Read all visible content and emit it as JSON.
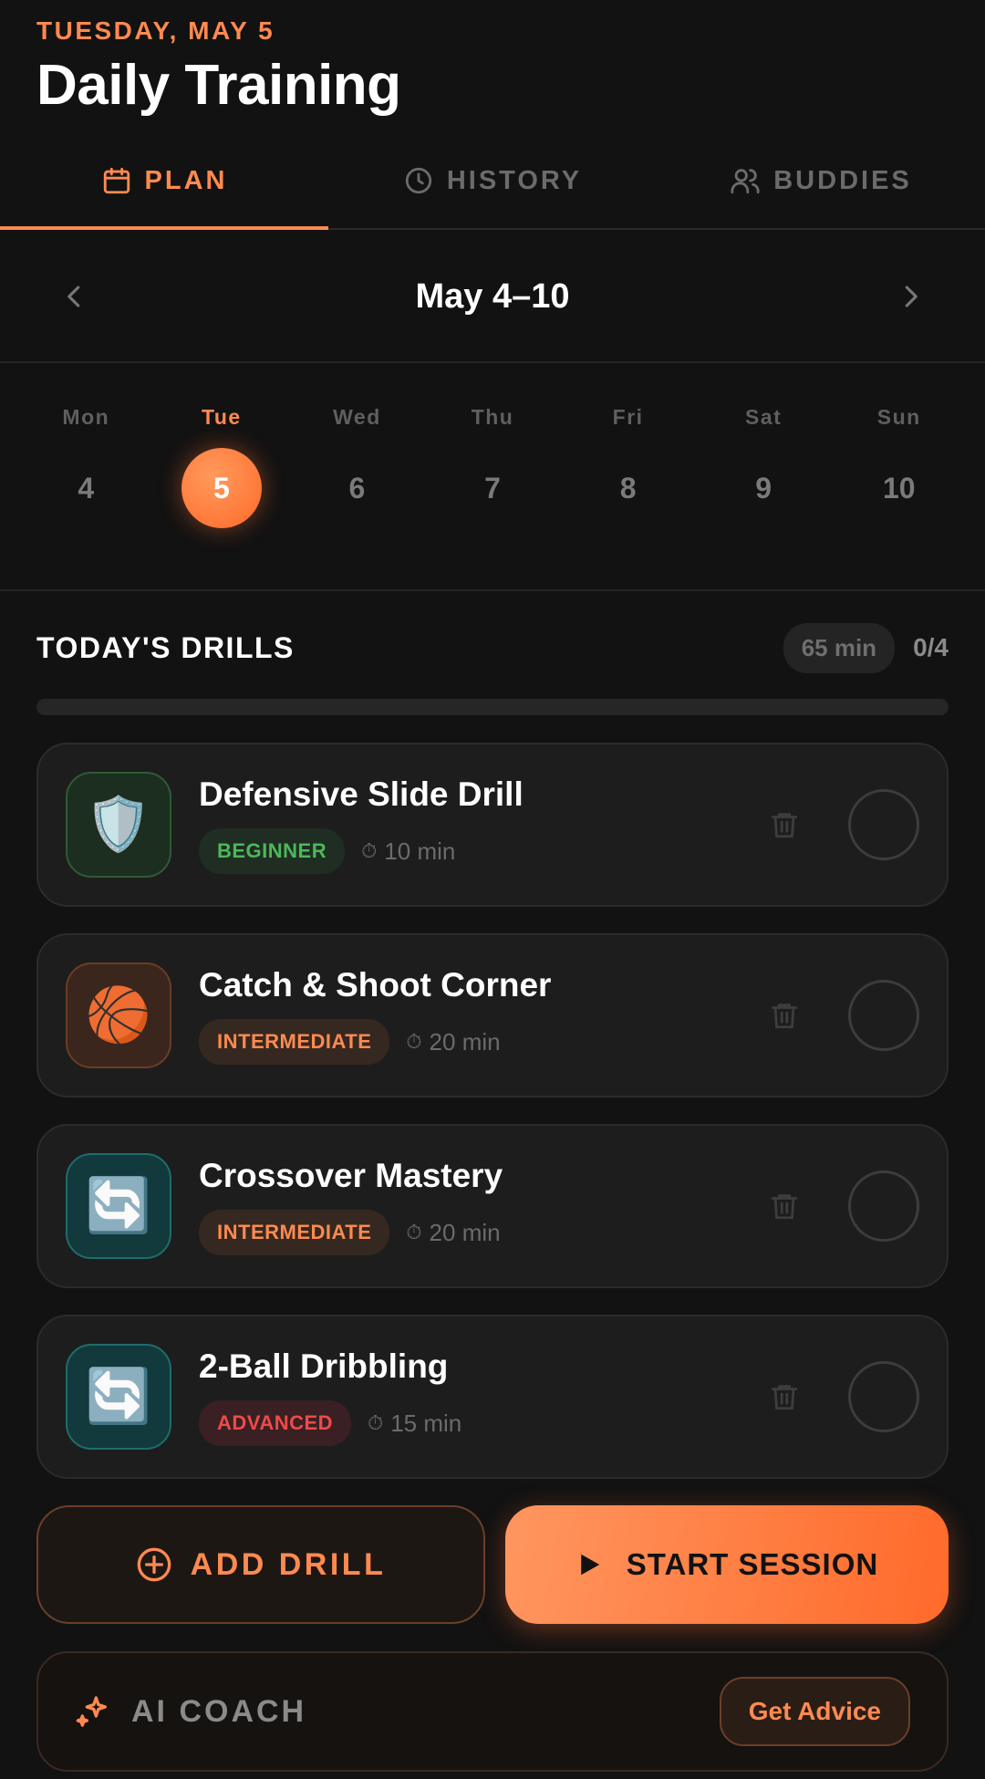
{
  "header": {
    "date": "TUESDAY, MAY 5",
    "title": "Daily Training"
  },
  "tabs": [
    {
      "label": "PLAN",
      "icon": "calendar-icon",
      "active": true
    },
    {
      "label": "HISTORY",
      "icon": "clock-icon",
      "active": false
    },
    {
      "label": "BUDDIES",
      "icon": "users-icon",
      "active": false
    }
  ],
  "week": {
    "title": "May 4–10",
    "prev_icon": "chevron-left-icon",
    "next_icon": "chevron-right-icon"
  },
  "days": [
    {
      "name": "Mon",
      "num": "4"
    },
    {
      "name": "Tue",
      "num": "5",
      "active": true
    },
    {
      "name": "Wed",
      "num": "6"
    },
    {
      "name": "Thu",
      "num": "7"
    },
    {
      "name": "Fri",
      "num": "8"
    },
    {
      "name": "Sat",
      "num": "9"
    },
    {
      "name": "Sun",
      "num": "10"
    }
  ],
  "drills_section": {
    "title": "TODAY'S DRILLS",
    "total_duration": "65 min",
    "progress_text": "0/4",
    "progress_fraction": 0
  },
  "drills": [
    {
      "title": "Defensive Slide Drill",
      "level": "BEGINNER",
      "level_key": "beginner",
      "duration": "10 min",
      "icon": "shield-icon",
      "glyph": "🛡️"
    },
    {
      "title": "Catch & Shoot Corner",
      "level": "INTERMEDIATE",
      "level_key": "intermediate",
      "duration": "20 min",
      "icon": "basketball-icon",
      "glyph": "🏀"
    },
    {
      "title": "Crossover Mastery",
      "level": "INTERMEDIATE",
      "level_key": "intermediate",
      "duration": "20 min",
      "icon": "repeat-arrows-icon",
      "glyph": "🔄"
    },
    {
      "title": "2-Ball Dribbling",
      "level": "ADVANCED",
      "level_key": "advanced",
      "duration": "15 min",
      "icon": "repeat-arrows-icon",
      "glyph": "🔄"
    }
  ],
  "actions": {
    "add_label": "ADD DRILL",
    "start_label": "START SESSION"
  },
  "ai_coach": {
    "title": "AI COACH",
    "button_label": "Get Advice"
  },
  "colors": {
    "accent": "#ff8a50",
    "background": "#121212",
    "beginner": "#4cb85a",
    "intermediate": "#ff8a50",
    "advanced": "#ef4a4a"
  }
}
